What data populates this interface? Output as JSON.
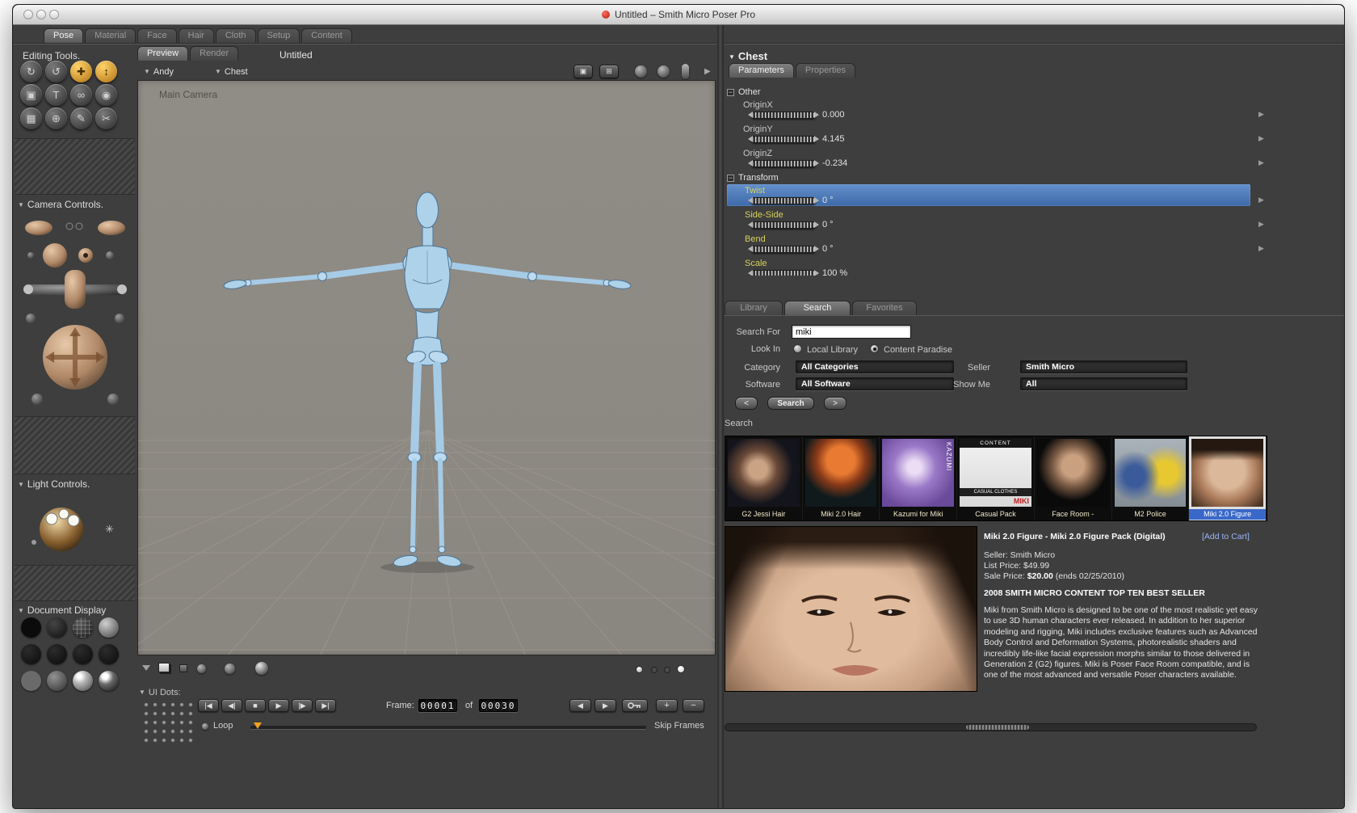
{
  "colors": {
    "accent_orange": "#f5a623",
    "selection_blue": "#4a7ab8",
    "param_label_yellow": "#d8d058",
    "figure_blue": "#aed2ea"
  },
  "window": {
    "title": "Untitled – Smith Micro Poser Pro"
  },
  "room_tabs": {
    "items": [
      "Pose",
      "Material",
      "Face",
      "Hair",
      "Cloth",
      "Setup",
      "Content"
    ]
  },
  "icons": {
    "dropdown": "▼",
    "row_arrow": "▶",
    "collapse": "−",
    "sun": "✳",
    "expand": "▶",
    "pane1": "▣",
    "pane2": "⊞",
    "first_frame": "|◀",
    "prev_frame": "◀|",
    "stop": "■",
    "play": "▶",
    "next_frame": "|▶",
    "last_frame": "▶|",
    "step_back": "◀",
    "step_forward": "▶",
    "add_key": "+",
    "remove_key": "−",
    "tools": [
      "↻",
      "↺",
      "✚",
      "↕",
      "▣",
      "T",
      "∞",
      "◉",
      "▦",
      "⊕",
      "✎",
      "✂"
    ]
  },
  "left_panel": {
    "editing_tools": "Editing Tools.",
    "camera_controls": "Camera Controls.",
    "light_controls": "Light Controls.",
    "document_display": "Document Display"
  },
  "viewport": {
    "tab_preview": "Preview",
    "tab_render": "Render",
    "doc_title": "Untitled",
    "figure_menu": "Andy",
    "actor_menu": "Chest",
    "camera_name": "Main Camera",
    "ui_dots": "UI Dots:"
  },
  "timeline": {
    "frame_label": "Frame:",
    "current": "00001",
    "of": "of",
    "total": "00030",
    "loop": "Loop",
    "skip_frames": "Skip Frames"
  },
  "params": {
    "actor": "Chest",
    "tab_parameters": "Parameters",
    "tab_properties": "Properties",
    "group_other": "Other",
    "group_transform": "Transform",
    "rows": [
      {
        "label": "OriginX",
        "value": "0.000"
      },
      {
        "label": "OriginY",
        "value": "4.145"
      },
      {
        "label": "OriginZ",
        "value": "-0.234"
      },
      {
        "label": "Twist",
        "value": "0 °"
      },
      {
        "label": "Side-Side",
        "value": "0 °"
      },
      {
        "label": "Bend",
        "value": "0 °"
      },
      {
        "label": "Scale",
        "value": "100 %"
      }
    ]
  },
  "library": {
    "tab_library": "Library",
    "tab_search": "Search",
    "tab_favorites": "Favorites",
    "search_for": "Search For",
    "search_value": "miki",
    "look_in": "Look In",
    "radio_local": "Local Library",
    "radio_paradise": "Content Paradise",
    "category": "Category",
    "category_value": "All Categories",
    "seller": "Seller",
    "seller_value": "Smith Micro",
    "software": "Software",
    "software_value": "All Software",
    "show_me": "Show Me",
    "show_me_value": "All",
    "prev": "<",
    "search_btn": "Search",
    "next": ">",
    "results_header": "Search",
    "thumbs": [
      {
        "label": "G2 Jessi Hair"
      },
      {
        "label": "Miki 2.0 Hair"
      },
      {
        "label": "Kazumi for Miki",
        "overlay": "KAZUMI"
      },
      {
        "label": "Casual Pack",
        "overlay_top": "CONTENT",
        "overlay_mid": "CASUAL CLOTHES",
        "overlay_brand": "MIKI"
      },
      {
        "label": "Face Room -"
      },
      {
        "label": "M2 Police"
      },
      {
        "label": "Miki 2.0 Figure"
      }
    ],
    "detail": {
      "title": "Miki 2.0 Figure - Miki 2.0 Figure Pack (Digital)",
      "add_to_cart": "[Add to Cart]",
      "seller": "Seller: Smith Micro",
      "list_price": "List Price: $49.99",
      "sale_prefix": "Sale Price: ",
      "sale_amount": "$20.00",
      "sale_suffix": " (ends 02/25/2010)",
      "banner": "2008 SMITH MICRO CONTENT TOP TEN BEST SELLER",
      "description": "Miki from Smith Micro is designed to be one of the most realistic yet easy to use 3D human characters ever released. In addition to her superior modeling and rigging, Miki includes exclusive features such as Advanced Body Control and Deformation Systems, photorealistic shaders and incredibly life-like facial expression morphs similar to those delivered in Generation 2 (G2) figures. Miki is Poser Face Room compatible, and is one of the most advanced and versatile Poser characters available."
    }
  }
}
